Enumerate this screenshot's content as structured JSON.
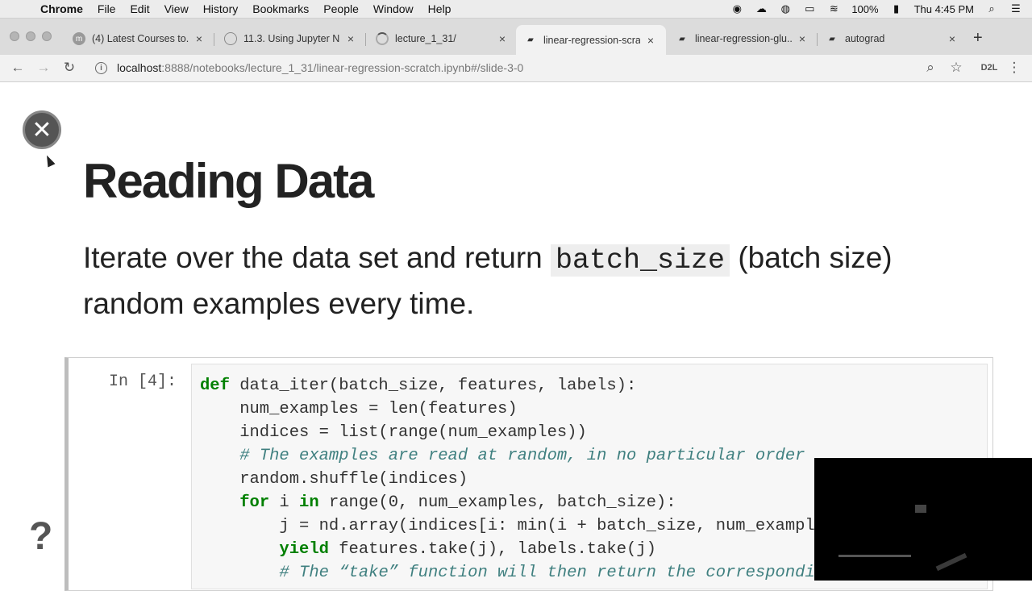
{
  "menubar": {
    "app_name": "Chrome",
    "menus": [
      "File",
      "Edit",
      "View",
      "History",
      "Bookmarks",
      "People",
      "Window",
      "Help"
    ],
    "battery": "100%",
    "clock": "Thu 4:45 PM"
  },
  "tabs": [
    {
      "title": "(4) Latest Courses to...",
      "icon": "udemy-icon"
    },
    {
      "title": "11.3. Using Jupyter N...",
      "icon": "d2l-icon"
    },
    {
      "title": "lecture_1_31/",
      "icon": "loading-icon"
    },
    {
      "title": "linear-regression-scra...",
      "icon": "notebook-icon",
      "active": true
    },
    {
      "title": "linear-regression-glu...",
      "icon": "notebook-icon"
    },
    {
      "title": "autograd",
      "icon": "notebook-icon"
    }
  ],
  "toolbar": {
    "url_host": "localhost",
    "url_rest": ":8888/notebooks/lecture_1_31/linear-regression-scratch.ipynb#/slide-3-0",
    "profile": "D2L"
  },
  "slide": {
    "title": "Reading Data",
    "text_before": "Iterate over the data set and return ",
    "code_term": "batch_size",
    "text_after": " (batch size) random examples every time."
  },
  "cell": {
    "prompt": "In [4]:"
  }
}
